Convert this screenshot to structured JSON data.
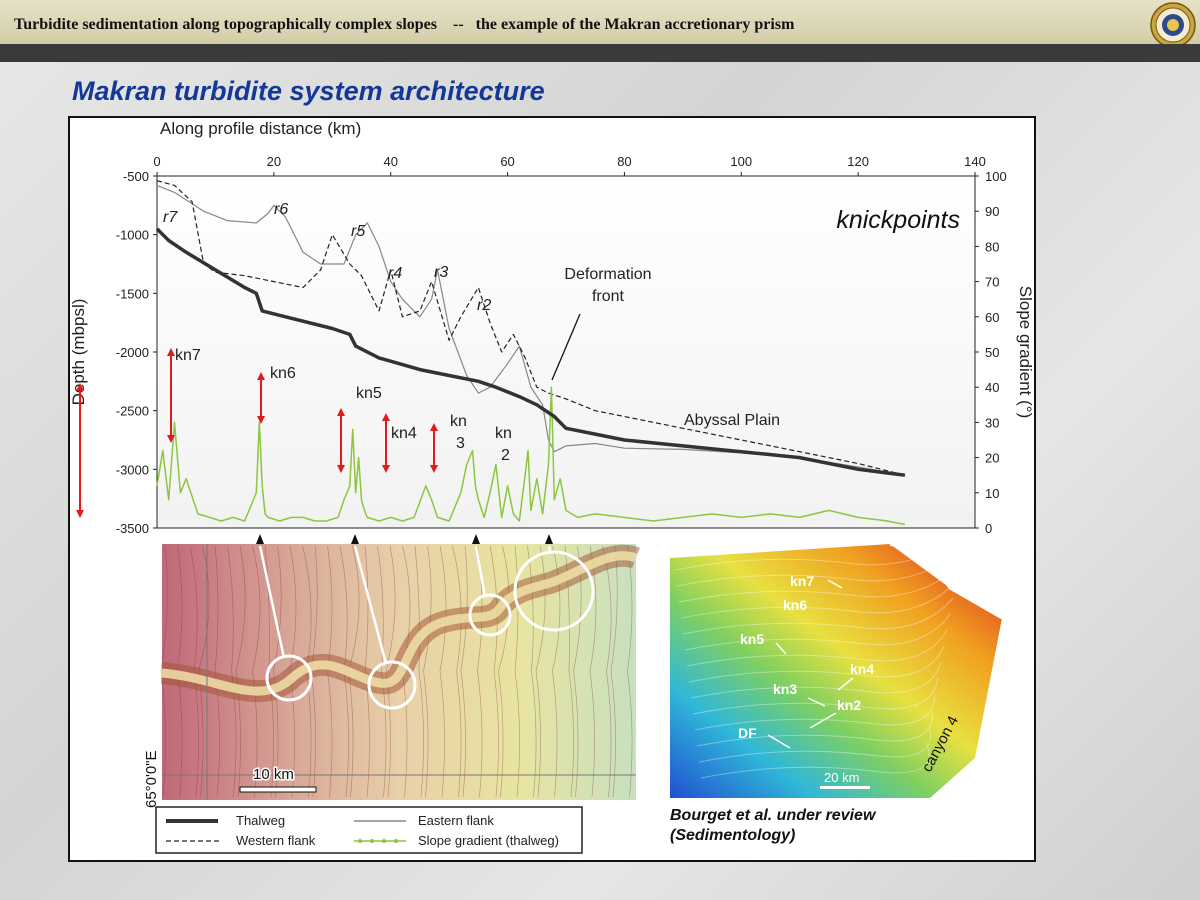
{
  "header": {
    "title": "Turbidite sedimentation along topographically complex slopes    --   the example of the Makran accretionary prism"
  },
  "slide_title": "Makran turbidite system architecture",
  "chart_data": {
    "type": "line",
    "xlabel": "Along profile distance (km)",
    "ylabel": "Depth (mbpsl)",
    "y2label": "Slope gradient (°)",
    "xlim": [
      0,
      140
    ],
    "ylim": [
      -3500,
      -500
    ],
    "y2lim": [
      0,
      100
    ],
    "x_ticks": [
      0,
      20,
      40,
      60,
      80,
      100,
      120,
      140
    ],
    "y_ticks": [
      -500,
      -1000,
      -1500,
      -2000,
      -2500,
      -3000,
      -3500
    ],
    "y2_ticks": [
      100,
      90,
      80,
      70,
      60,
      50,
      40,
      30,
      20,
      10,
      0
    ],
    "series": [
      {
        "name": "Thalweg",
        "color": "#333333",
        "x": [
          0,
          2,
          5,
          10,
          15,
          17,
          18,
          22,
          30,
          33,
          34,
          38,
          45,
          50,
          55,
          58,
          62,
          65,
          68,
          70,
          75,
          80,
          90,
          100,
          110,
          120,
          128
        ],
        "y": [
          -950,
          -1050,
          -1150,
          -1300,
          -1450,
          -1500,
          -1650,
          -1700,
          -1800,
          -1850,
          -1950,
          -2050,
          -2150,
          -2200,
          -2250,
          -2300,
          -2380,
          -2450,
          -2550,
          -2650,
          -2700,
          -2750,
          -2800,
          -2850,
          -2900,
          -3000,
          -3050
        ]
      },
      {
        "name": "Eastern flank",
        "color": "#888888",
        "x": [
          0,
          3,
          8,
          12,
          17,
          19,
          20,
          22,
          25,
          28,
          32,
          34,
          36,
          38,
          40,
          42,
          45,
          47,
          48,
          50,
          53,
          55,
          57,
          60,
          62,
          64,
          66,
          67,
          68,
          70,
          75,
          80,
          90,
          100,
          110,
          120,
          128
        ],
        "y": [
          -580,
          -640,
          -800,
          -880,
          -900,
          -820,
          -750,
          -850,
          -1150,
          -1250,
          -1250,
          -1000,
          -900,
          -1100,
          -1400,
          -1550,
          -1700,
          -1550,
          -1300,
          -1800,
          -2200,
          -2350,
          -2300,
          -2100,
          -1950,
          -2300,
          -2450,
          -2750,
          -2850,
          -2800,
          -2780,
          -2820,
          -2830,
          -2860,
          -2900,
          -2980,
          -3050
        ]
      },
      {
        "name": "Western flank",
        "color": "#222222",
        "dash": true,
        "x": [
          0,
          3,
          6,
          8,
          10,
          15,
          20,
          25,
          28,
          30,
          33,
          35,
          38,
          40,
          42,
          45,
          47,
          50,
          52,
          55,
          57,
          59,
          61,
          63,
          65,
          67,
          70,
          75,
          80,
          90,
          100,
          110,
          120,
          128
        ],
        "y": [
          -540,
          -580,
          -720,
          -1250,
          -1320,
          -1350,
          -1400,
          -1450,
          -1300,
          -1000,
          -1250,
          -1350,
          -1650,
          -1300,
          -1700,
          -1650,
          -1400,
          -1900,
          -1700,
          -1450,
          -1750,
          -2000,
          -1850,
          -2050,
          -2300,
          -2350,
          -2400,
          -2500,
          -2550,
          -2650,
          -2750,
          -2850,
          -2950,
          -3050
        ]
      },
      {
        "name": "Slope gradient (thalweg)",
        "color": "#8cc63f",
        "axis": "y2",
        "x": [
          0,
          1,
          2,
          3,
          4,
          5,
          7,
          9,
          11,
          13,
          15,
          16,
          17,
          17.5,
          18,
          18.5,
          19,
          21,
          23,
          25,
          27,
          29,
          31,
          32,
          33,
          33.5,
          34,
          34.5,
          35,
          35.5,
          36,
          38,
          40,
          42,
          44,
          46,
          47,
          48,
          50,
          52,
          53,
          54,
          54.5,
          55,
          56,
          57,
          58,
          59,
          60,
          61,
          62,
          63,
          63.5,
          64,
          65,
          66,
          67,
          67.5,
          68,
          69,
          70,
          72,
          75,
          80,
          85,
          90,
          95,
          100,
          105,
          110,
          115,
          120,
          125,
          128
        ],
        "y": [
          12,
          22,
          8,
          30,
          10,
          14,
          4,
          3,
          2,
          3,
          2,
          6,
          10,
          30,
          12,
          4,
          3,
          2,
          3,
          3,
          2,
          2,
          3,
          8,
          12,
          28,
          10,
          20,
          8,
          5,
          3,
          2,
          3,
          2,
          3,
          12,
          8,
          3,
          2,
          10,
          18,
          22,
          12,
          8,
          3,
          10,
          18,
          3,
          12,
          4,
          2,
          15,
          22,
          5,
          14,
          4,
          18,
          40,
          8,
          14,
          5,
          3,
          4,
          3,
          2,
          3,
          4,
          3,
          4,
          3,
          5,
          3,
          2,
          1
        ]
      }
    ],
    "annotations": {
      "reaches": [
        "r7",
        "r6",
        "r5",
        "r4",
        "r3",
        "r2"
      ],
      "knickpoints": [
        "kn7",
        "kn6",
        "kn5",
        "kn4",
        "kn",
        "3",
        "kn",
        "2"
      ],
      "knickpoints_label": "knickpoints",
      "deformation_front": [
        "Deformation",
        "front"
      ],
      "abyssal_plain": "Abyssal Plain"
    }
  },
  "map_left": {
    "longitude_label": "65°0'0\"E",
    "scale_label": "10 km"
  },
  "map_right": {
    "labels": [
      "kn7",
      "kn6",
      "kn5",
      "kn4",
      "kn3",
      "kn2",
      "DF"
    ],
    "canyon_label": "canyon 4",
    "scale_label": "20 km"
  },
  "legend": {
    "items": [
      "Thalweg",
      "Eastern flank",
      "Western flank",
      "Slope gradient (thalweg)"
    ]
  },
  "citation": {
    "line1": "Bourget et al. under review",
    "line2": "(Sedimentology)"
  }
}
